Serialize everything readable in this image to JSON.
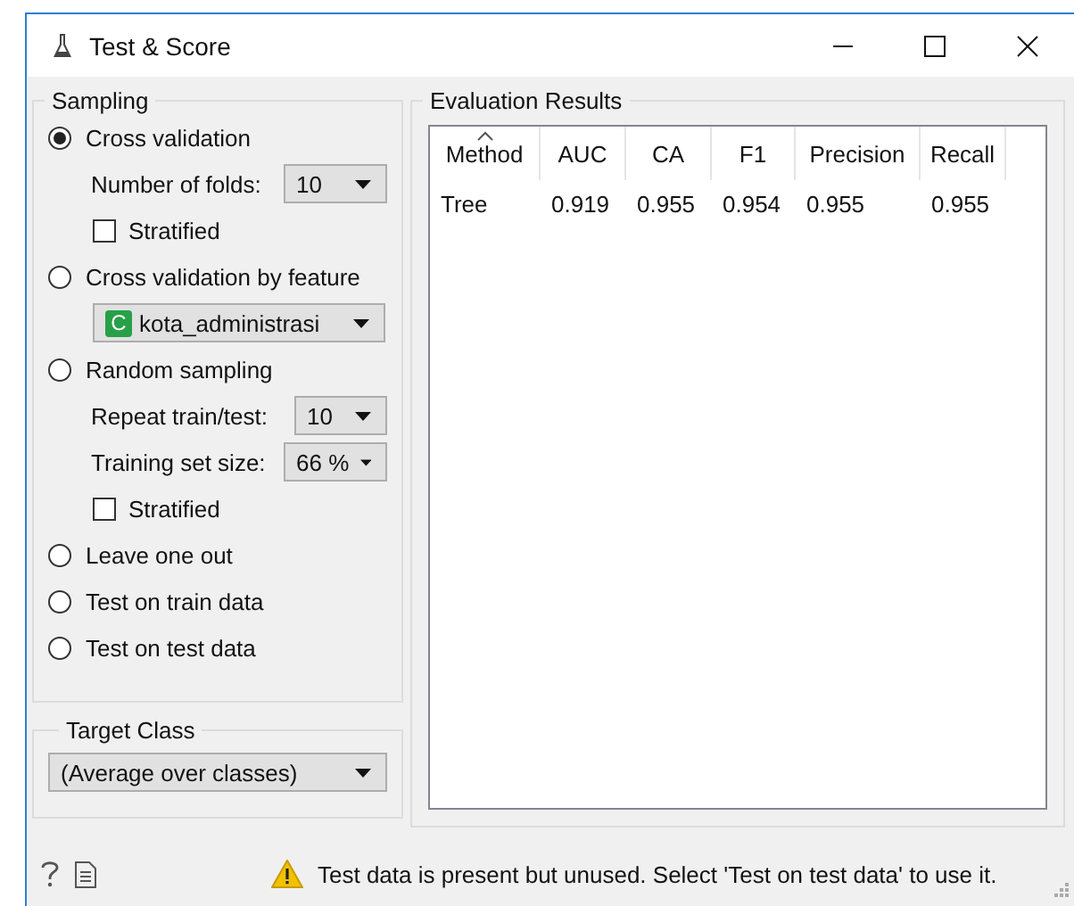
{
  "window": {
    "title": "Test & Score"
  },
  "sampling": {
    "title": "Sampling",
    "options": [
      {
        "kind": "radio",
        "label": "Cross validation",
        "selected": true
      },
      {
        "kind": "combo",
        "label": "Number of folds:",
        "value": "10"
      },
      {
        "kind": "checkbox",
        "label": "Stratified",
        "checked": false
      },
      {
        "kind": "radio",
        "label": "Cross validation by feature",
        "selected": false
      },
      {
        "kind": "feature",
        "badge": "C",
        "value": "kota_administrasi"
      },
      {
        "kind": "radio",
        "label": "Random sampling",
        "selected": false
      },
      {
        "kind": "combo",
        "label": "Repeat train/test:",
        "value": "10"
      },
      {
        "kind": "combo",
        "label": "Training set size:",
        "value": "66 %"
      },
      {
        "kind": "checkbox",
        "label": "Stratified",
        "checked": false
      },
      {
        "kind": "radio",
        "label": "Leave one out",
        "selected": false
      },
      {
        "kind": "radio",
        "label": "Test on train data",
        "selected": false
      },
      {
        "kind": "radio",
        "label": "Test on test data",
        "selected": false
      }
    ]
  },
  "target_class": {
    "title": "Target Class",
    "value": "(Average over classes)"
  },
  "evaluation": {
    "title": "Evaluation Results",
    "columns": [
      {
        "label": "Method",
        "sorted": true
      },
      {
        "label": "AUC",
        "sorted": false
      },
      {
        "label": "CA",
        "sorted": false
      },
      {
        "label": "F1",
        "sorted": false
      },
      {
        "label": "Precision",
        "sorted": false
      },
      {
        "label": "Recall",
        "sorted": false
      }
    ],
    "rows": [
      {
        "cells": [
          "Tree",
          "0.919",
          "0.955",
          "0.954",
          "0.955",
          "0.955"
        ]
      }
    ]
  },
  "status_bar": {
    "message": "Test data is present but unused. Select 'Test on test data' to use it."
  }
}
